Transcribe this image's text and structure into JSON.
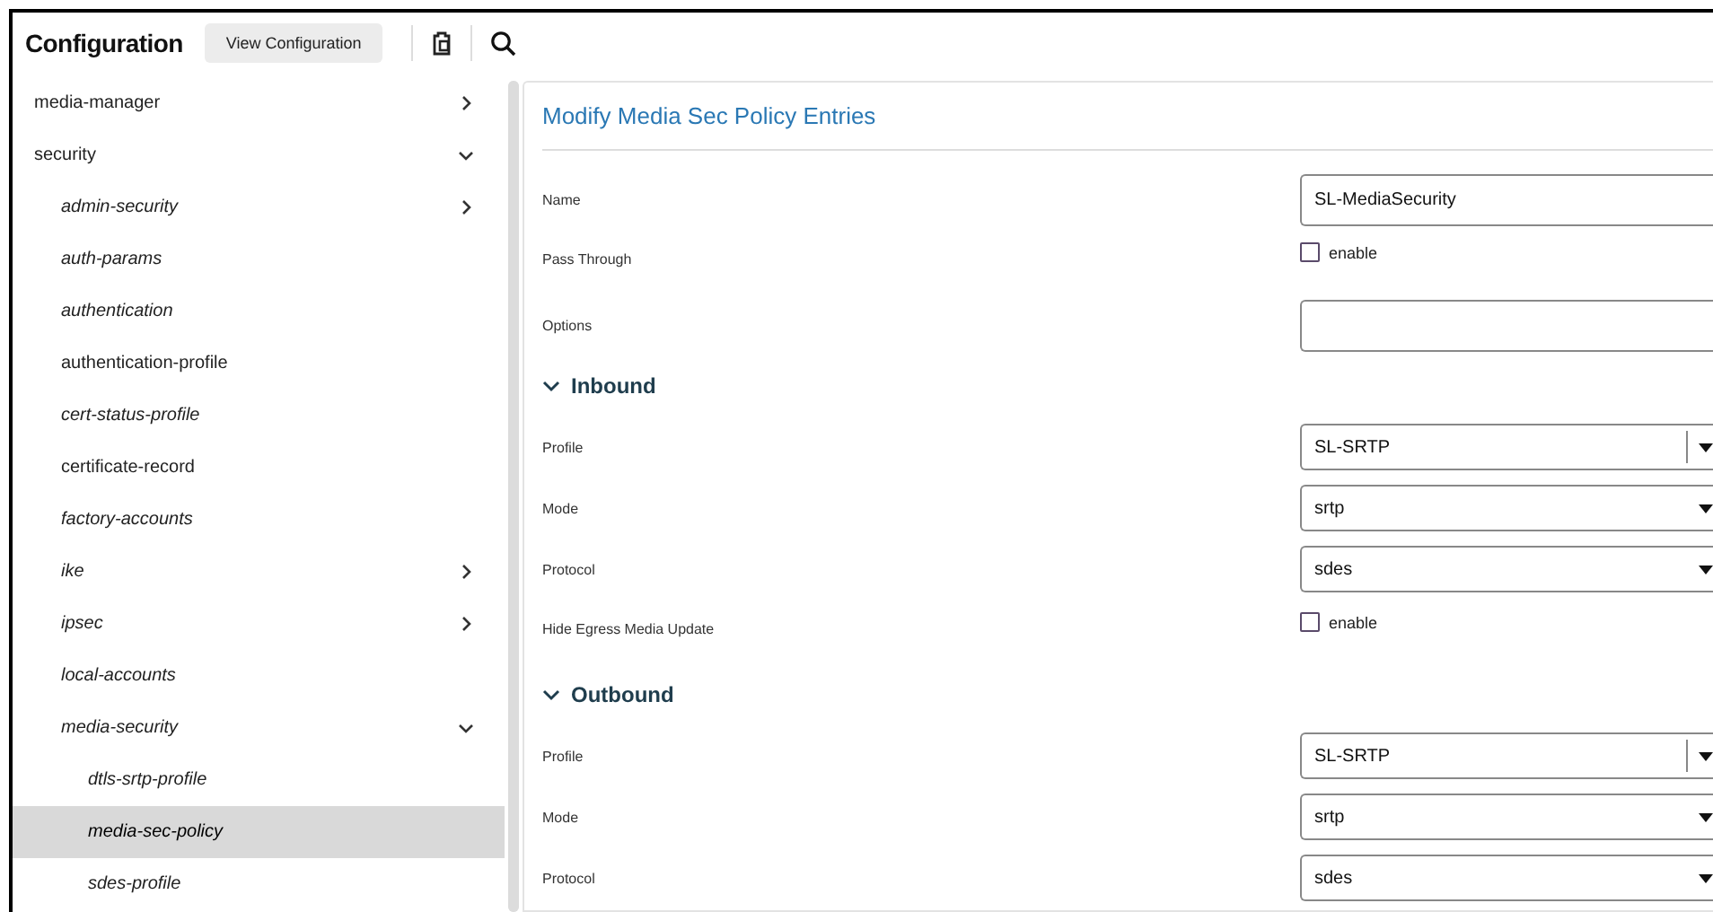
{
  "header": {
    "title": "Configuration",
    "button": "View Configuration"
  },
  "tree": [
    {
      "label": "media-manager",
      "italic": false,
      "selected": false,
      "expanded": false
    },
    {
      "label": "security",
      "italic": false,
      "selected": false,
      "expanded": true,
      "children": [
        {
          "label": "admin-security",
          "italic": true,
          "selected": false,
          "expanded": false
        },
        {
          "label": "auth-params",
          "italic": true,
          "selected": false
        },
        {
          "label": "authentication",
          "italic": true,
          "selected": false
        },
        {
          "label": "authentication-profile",
          "italic": false,
          "selected": false
        },
        {
          "label": "cert-status-profile",
          "italic": true,
          "selected": false
        },
        {
          "label": "certificate-record",
          "italic": false,
          "selected": false
        },
        {
          "label": "factory-accounts",
          "italic": true,
          "selected": false
        },
        {
          "label": "ike",
          "italic": true,
          "selected": false,
          "expanded": false
        },
        {
          "label": "ipsec",
          "italic": true,
          "selected": false,
          "expanded": false
        },
        {
          "label": "local-accounts",
          "italic": true,
          "selected": false
        },
        {
          "label": "media-security",
          "italic": true,
          "selected": false,
          "expanded": true,
          "children": [
            {
              "label": "dtls-srtp-profile",
              "italic": true,
              "selected": false
            },
            {
              "label": "media-sec-policy",
              "italic": true,
              "selected": true
            },
            {
              "label": "sdes-profile",
              "italic": true,
              "selected": false
            }
          ]
        }
      ]
    }
  ],
  "form": {
    "title": "Modify Media Sec Policy Entries",
    "rows": [
      {
        "kind": "text",
        "label": "Name",
        "value": "SL-MediaSecurity"
      },
      {
        "kind": "checkbox",
        "label": "Pass Through",
        "option": "enable",
        "checked": false
      },
      {
        "kind": "text",
        "label": "Options"
      },
      {
        "kind": "section",
        "label": "Inbound",
        "expanded": true
      },
      {
        "kind": "combobox",
        "label": "Profile",
        "value": "SL-SRTP"
      },
      {
        "kind": "select",
        "label": "Mode",
        "value": "srtp"
      },
      {
        "kind": "select",
        "label": "Protocol",
        "value": "sdes"
      },
      {
        "kind": "checkbox",
        "label": "Hide Egress Media Update",
        "option": "enable",
        "checked": false
      },
      {
        "kind": "section",
        "label": "Outbound",
        "expanded": true
      },
      {
        "kind": "combobox",
        "label": "Profile",
        "value": "SL-SRTP"
      },
      {
        "kind": "select",
        "label": "Mode",
        "value": "srtp"
      },
      {
        "kind": "select",
        "label": "Protocol",
        "value": "sdes"
      }
    ]
  }
}
